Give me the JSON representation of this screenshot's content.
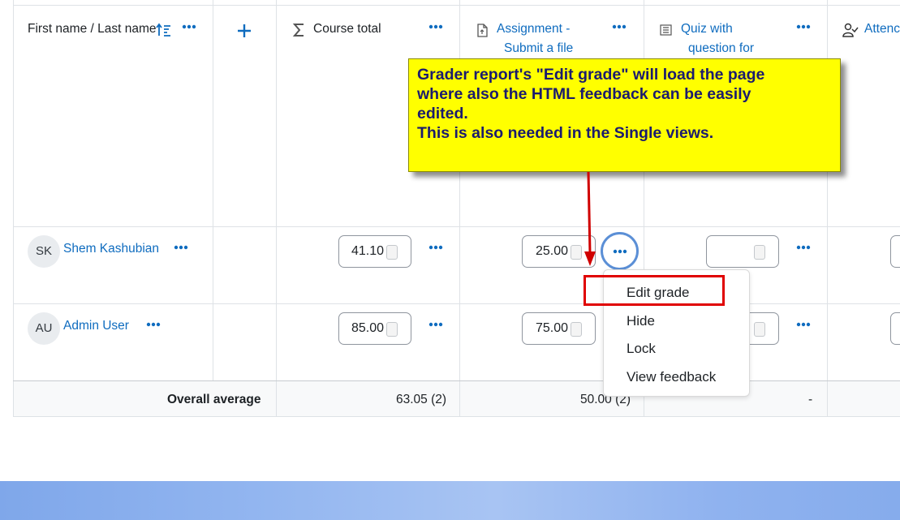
{
  "columns": {
    "name_header": "First name / Last name",
    "course_total": "Course total",
    "assignment_line1": "Assignment -",
    "assignment_line2": "Submit a file",
    "quiz_line1": "Quiz with",
    "quiz_line2": "question for",
    "attendance": "Attenc"
  },
  "rows": [
    {
      "initials": "SK",
      "name": "Shem Kashubian",
      "course_total": "41.10",
      "assignment": "25.00",
      "quiz": ""
    },
    {
      "initials": "AU",
      "name": "Admin User",
      "course_total": "85.00",
      "assignment": "75.00",
      "quiz": ""
    }
  ],
  "overall": {
    "label": "Overall average",
    "course_total": "63.05 (2)",
    "assignment": "50.00 (2)",
    "quiz": "-"
  },
  "menu": {
    "items": [
      "Edit grade",
      "Hide",
      "Lock",
      "View feedback"
    ]
  },
  "callout": {
    "lines": [
      "Grader report's \"Edit grade\" will load the  page",
      "where also the HTML feedback can be easily",
      "edited.",
      "This is also needed in the Single views."
    ]
  },
  "colors": {
    "link": "#0f6cbf",
    "callout_bg": "#ffff00",
    "callout_text": "#1b1b6e",
    "highlight_box": "#e00000",
    "arrow": "#d00000"
  }
}
